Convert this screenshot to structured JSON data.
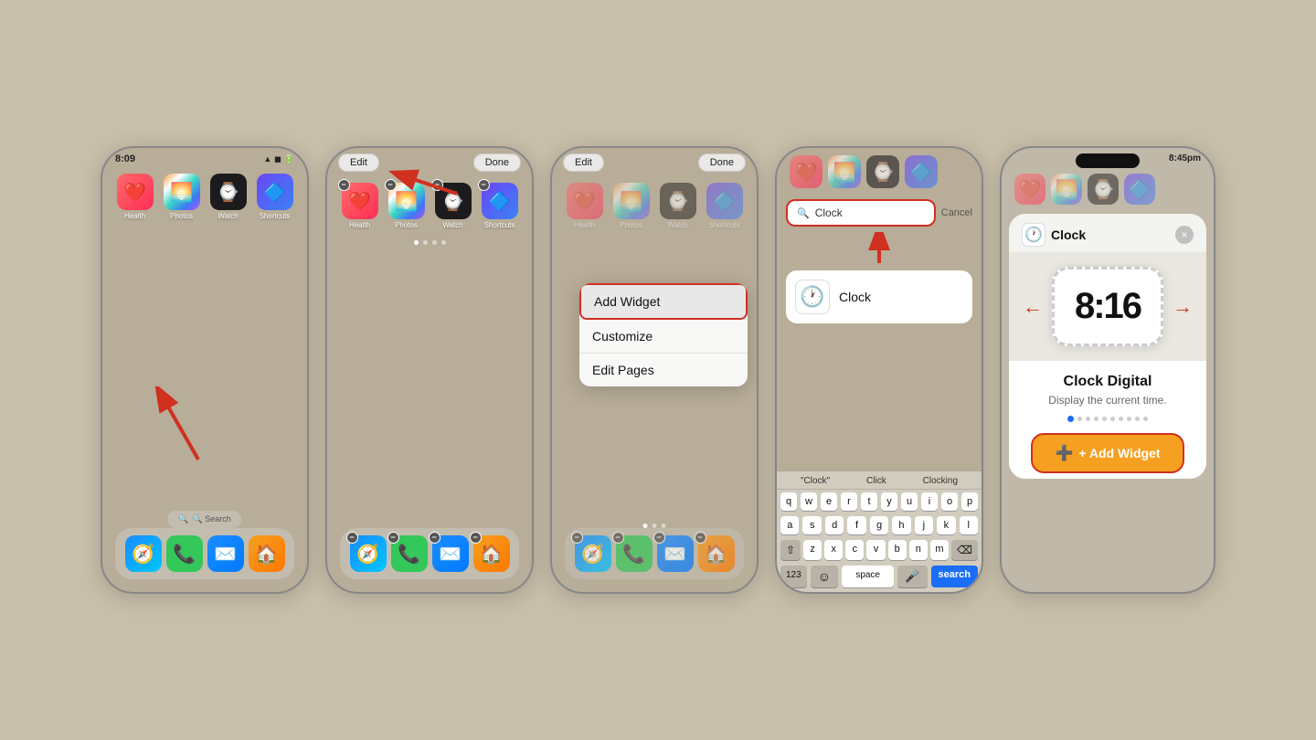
{
  "page": {
    "bg_color": "#c8bfaa"
  },
  "phone1": {
    "status_time": "8:09",
    "status_icons": "▲ ◼ 🔋",
    "apps": [
      {
        "name": "Health",
        "emoji": "❤️",
        "bg": "health-icon"
      },
      {
        "name": "Photos",
        "emoji": "🌅",
        "bg": "photos-icon"
      },
      {
        "name": "Watch",
        "emoji": "⌚",
        "bg": "watch-icon"
      },
      {
        "name": "Shortcuts",
        "emoji": "🔷",
        "bg": "shortcuts-icon"
      }
    ],
    "dock": [
      {
        "emoji": "🧭",
        "bg": "safari-icon"
      },
      {
        "emoji": "📞",
        "bg": "phone-icon"
      },
      {
        "emoji": "✉️",
        "bg": "mail-icon"
      },
      {
        "emoji": "🏠",
        "bg": "home-icon"
      }
    ],
    "search_label": "🔍 Search"
  },
  "phone2": {
    "status_time": "",
    "edit_label": "Edit",
    "done_label": "Done",
    "apps": [
      {
        "name": "Health",
        "emoji": "❤️",
        "bg": "health-icon"
      },
      {
        "name": "Photos",
        "emoji": "🌅",
        "bg": "photos-icon"
      },
      {
        "name": "Watch",
        "emoji": "⌚",
        "bg": "watch-icon"
      },
      {
        "name": "Shortcuts",
        "emoji": "🔷",
        "bg": "shortcuts-icon"
      }
    ],
    "dock": [
      {
        "emoji": "🧭",
        "bg": "safari-icon"
      },
      {
        "emoji": "📞",
        "bg": "phone-icon"
      },
      {
        "emoji": "✉️",
        "bg": "mail-icon"
      },
      {
        "emoji": "🏠",
        "bg": "home-icon"
      }
    ]
  },
  "phone3": {
    "edit_label": "Edit",
    "done_label": "Done",
    "menu_items": [
      {
        "label": "Add Widget",
        "highlighted": true
      },
      {
        "label": "Customize",
        "highlighted": false
      },
      {
        "label": "Edit Pages",
        "highlighted": false
      }
    ],
    "apps": [
      {
        "name": "Health",
        "emoji": "❤️",
        "bg": "health-icon"
      },
      {
        "name": "Photos",
        "emoji": "🌅",
        "bg": "photos-icon"
      },
      {
        "name": "Watch",
        "emoji": "⌚",
        "bg": "watch-icon"
      },
      {
        "name": "Shortcuts",
        "emoji": "🔷",
        "bg": "shortcuts-icon"
      }
    ],
    "dock": [
      {
        "emoji": "🧭",
        "bg": "safari-icon"
      },
      {
        "emoji": "📞",
        "bg": "phone-icon"
      },
      {
        "emoji": "✉️",
        "bg": "mail-icon"
      },
      {
        "emoji": "🏠",
        "bg": "home-icon"
      }
    ]
  },
  "phone4": {
    "search_value": "Clock",
    "cancel_label": "Cancel",
    "result_name": "Clock",
    "result_emoji": "🕐",
    "keyboard_suggestions": [
      "\"Clock\"",
      "Click",
      "Clocking"
    ],
    "keyboard_rows": [
      [
        "q",
        "w",
        "e",
        "r",
        "t",
        "y",
        "u",
        "i",
        "o",
        "p"
      ],
      [
        "a",
        "s",
        "d",
        "f",
        "g",
        "h",
        "j",
        "k",
        "l"
      ],
      [
        "z",
        "x",
        "c",
        "v",
        "b",
        "n",
        "m"
      ]
    ],
    "key_123": "123",
    "key_space": "space",
    "key_search": "search",
    "key_delete": "⌫",
    "key_shift": "⇧"
  },
  "phone5": {
    "status_time": "8:45pm",
    "widget_title": "Clock",
    "close_label": "×",
    "clock_display": "8:16",
    "widget_name": "Clock Digital",
    "widget_desc": "Display the current time.",
    "add_widget_label": "+ Add Widget",
    "dots_count": 10,
    "active_dot": 0
  }
}
